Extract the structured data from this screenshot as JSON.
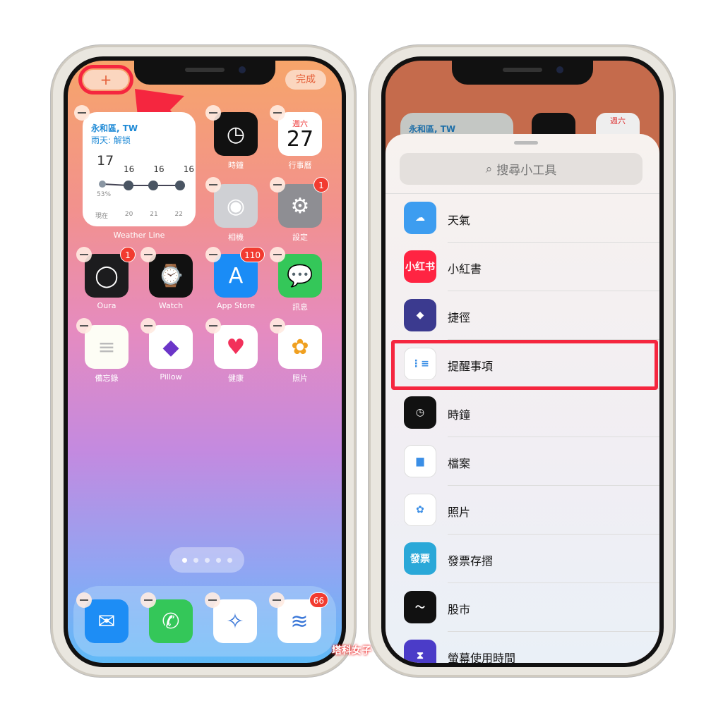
{
  "left": {
    "add_button": "+",
    "done_button": "完成",
    "weather_widget": {
      "location": "永和區, TW",
      "condition": "雨天: 解锁",
      "now_temp": "17",
      "temps": [
        "16",
        "16",
        "16"
      ],
      "humidity": "53%",
      "times": [
        "現在",
        "20",
        "21",
        "22"
      ],
      "label": "Weather Line"
    },
    "calendar": {
      "weekday": "週六",
      "day": "27"
    },
    "apps": [
      {
        "label": "時鐘",
        "icon": "clock-icon",
        "bg": "#111"
      },
      {
        "label": "行事曆",
        "icon": "calendar-icon",
        "bg": "#fff"
      },
      {
        "label": "相機",
        "icon": "camera-icon",
        "bg": "#cfd0d4"
      },
      {
        "label": "設定",
        "icon": "settings-gear-icon",
        "bg": "#8e8e93",
        "badge": "1"
      },
      {
        "label": "Oura",
        "icon": "oura-ring-icon",
        "bg": "#1c1c1e",
        "badge": "1"
      },
      {
        "label": "Watch",
        "icon": "watch-icon",
        "bg": "#111"
      },
      {
        "label": "App Store",
        "icon": "app-store-icon",
        "bg": "#1a8cf6",
        "badge": "110"
      },
      {
        "label": "訊息",
        "icon": "messages-icon",
        "bg": "#34c759"
      },
      {
        "label": "備忘錄",
        "icon": "notes-icon",
        "bg": "#fdfdf5"
      },
      {
        "label": "Pillow",
        "icon": "pillow-icon",
        "bg": "#fff"
      },
      {
        "label": "健康",
        "icon": "health-heart-icon",
        "bg": "#fff"
      },
      {
        "label": "照片",
        "icon": "photos-icon",
        "bg": "#fff"
      }
    ],
    "dock": [
      {
        "icon": "mail-icon",
        "bg": "#1d8df5"
      },
      {
        "icon": "phone-icon",
        "bg": "#34c759"
      },
      {
        "icon": "safari-icon",
        "bg": "#fff"
      },
      {
        "icon": "todoist-icon",
        "bg": "#fff",
        "badge": "66"
      }
    ]
  },
  "right": {
    "bg_widget_location": "永和區, TW",
    "bg_calendar_weekday": "週六",
    "search_placeholder": "搜尋小工具",
    "widgets": [
      {
        "name": "天氣",
        "icon": "weather-icon",
        "bg": "#3d9df0",
        "glyph": "☁"
      },
      {
        "name": "小紅書",
        "icon": "xiaohongshu-icon",
        "bg": "#ff2442",
        "glyph": "小红书"
      },
      {
        "name": "捷徑",
        "icon": "shortcuts-icon",
        "bg": "#3b3a8f",
        "glyph": "◆"
      },
      {
        "name": "提醒事項",
        "icon": "reminders-icon",
        "bg": "#fff",
        "glyph": "⋮≡"
      },
      {
        "name": "時鐘",
        "icon": "clock-icon",
        "bg": "#111",
        "glyph": "◷"
      },
      {
        "name": "檔案",
        "icon": "files-folder-icon",
        "bg": "#fff",
        "glyph": "▆"
      },
      {
        "name": "照片",
        "icon": "photos-icon",
        "bg": "#fff",
        "glyph": "✿"
      },
      {
        "name": "發票存摺",
        "icon": "invoice-icon",
        "bg": "#2aa8d8",
        "glyph": "發票"
      },
      {
        "name": "股市",
        "icon": "stocks-icon",
        "bg": "#111",
        "glyph": "〜"
      },
      {
        "name": "螢幕使用時間",
        "icon": "screen-time-icon",
        "bg": "#4b3cc8",
        "glyph": "⧗"
      }
    ],
    "highlight_color": "#f5263f"
  },
  "watermark": "塔科女子"
}
